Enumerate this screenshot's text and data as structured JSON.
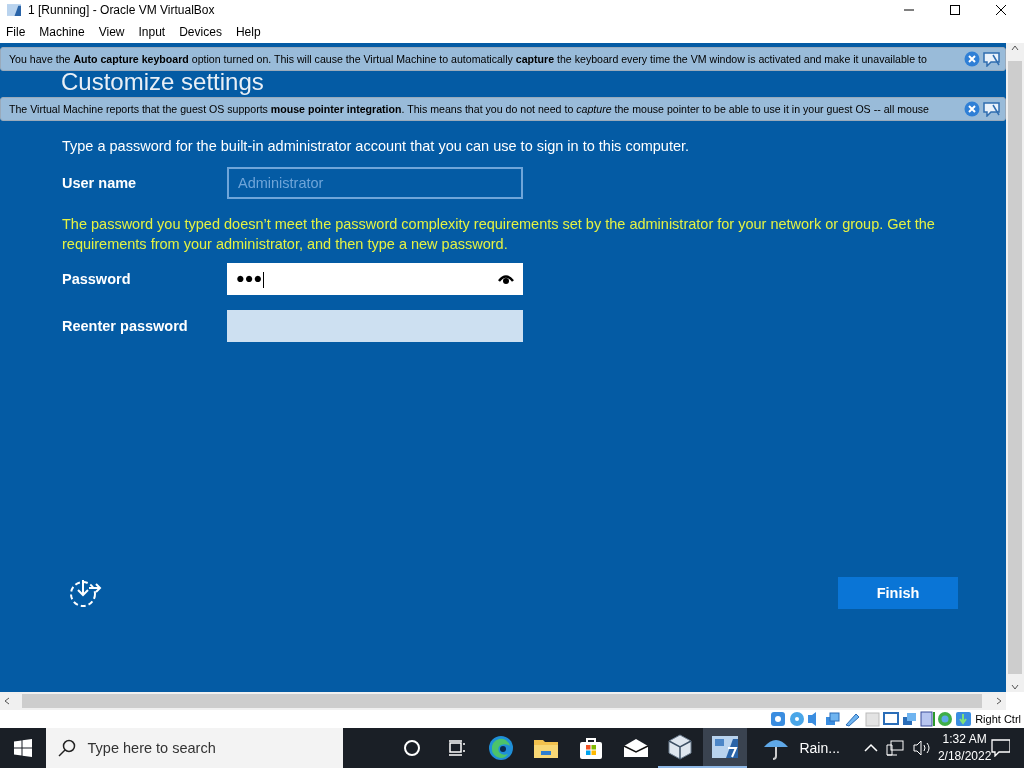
{
  "window": {
    "title": "1 [Running] - Oracle VM VirtualBox"
  },
  "menu": [
    "File",
    "Machine",
    "View",
    "Input",
    "Devices",
    "Help"
  ],
  "notices": [
    {
      "text": "You have the **Auto capture keyboard** option turned on. This will cause the Virtual Machine to automatically **capture** the keyboard every time the VM window is activated and make it unavailable to"
    },
    {
      "text": "The Virtual Machine reports that the guest OS supports **mouse pointer integration**. This means that you do not need to *capture* the mouse pointer to be able to use it in your guest OS -- all mouse"
    }
  ],
  "setup": {
    "heading": "Customize settings",
    "description": "Type a password for the built-in administrator account that you can use to sign in to this computer.",
    "fields": [
      {
        "label": "User name",
        "placeholder": "Administrator",
        "kind": "disabled"
      },
      {
        "label": "Password",
        "value": "●●●",
        "kind": "focused",
        "error": "The password you typed doesn’t meet the password complexity requirements set by the administrator for your network or group. Get the requirements from your administrator, and then type a new password."
      },
      {
        "label": "Reenter password",
        "kind": "empty"
      }
    ],
    "button": "Finish"
  },
  "status_bar": {
    "host_key": "Right Ctrl"
  },
  "taskbar": {
    "search_placeholder": "Type here to search",
    "apps": [
      {
        "kind": "edge",
        "running": false,
        "selected": false
      },
      {
        "kind": "folder",
        "running": false,
        "selected": false
      },
      {
        "kind": "store",
        "running": false,
        "selected": false
      },
      {
        "kind": "mail",
        "running": false,
        "selected": false
      },
      {
        "kind": "virtualbox",
        "running": true,
        "selected": false
      },
      {
        "kind": "vm",
        "running": true,
        "selected": true
      }
    ],
    "weather": "Rain...",
    "time": "1:32 AM",
    "date": "2/18/2022"
  }
}
